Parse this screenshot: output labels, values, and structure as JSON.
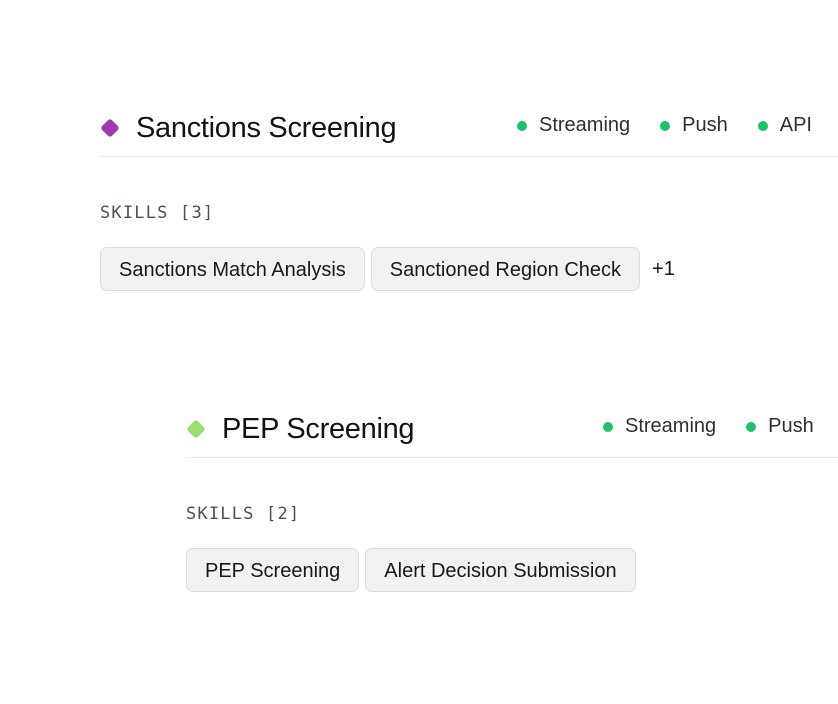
{
  "colors": {
    "status_dot": "#1fc16b",
    "sanctions_accent": "#a43aa8",
    "pep_accent": "#9be06f"
  },
  "cards": [
    {
      "title": "Sanctions Screening",
      "channels": [
        "Streaming",
        "Push",
        "API"
      ],
      "skills_label": "SKILLS [3]",
      "skills": [
        "Sanctions Match Analysis",
        "Sanctioned Region Check"
      ],
      "more": "+1"
    },
    {
      "title": "PEP Screening",
      "channels": [
        "Streaming",
        "Push"
      ],
      "skills_label": "SKILLS [2]",
      "skills": [
        "PEP Screening",
        "Alert Decision Submission"
      ]
    }
  ]
}
